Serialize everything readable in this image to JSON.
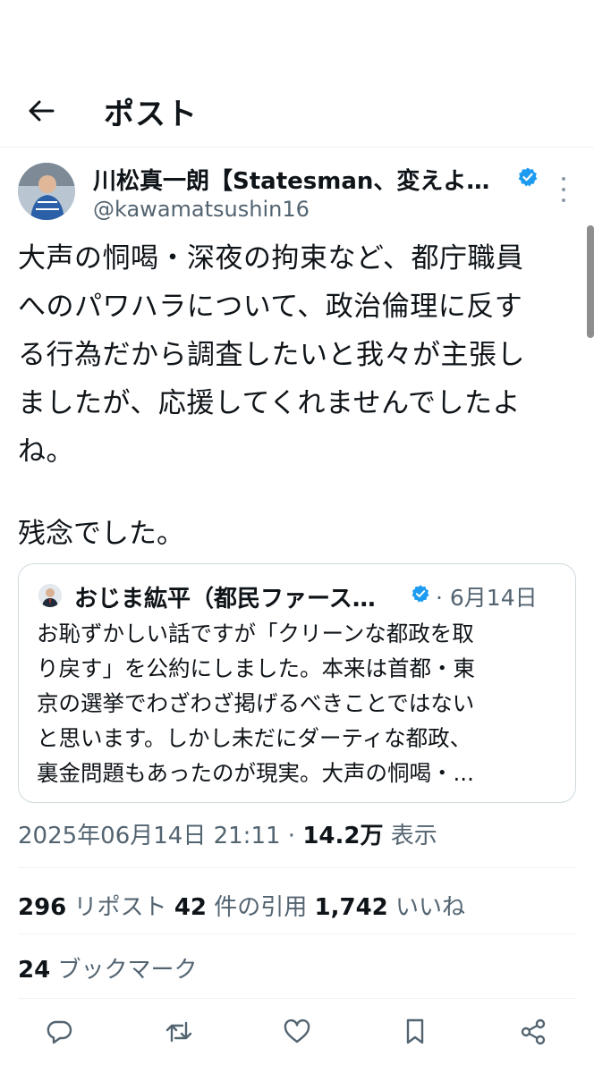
{
  "header": {
    "title": "ポスト",
    "back_icon": "arrow-left-icon"
  },
  "author": {
    "name": "川松真一朗【Statesman、変えよ…",
    "handle": "@kawamatsushin16",
    "verified_icon": "verified-badge-icon",
    "verified_color": "#1d9bf0"
  },
  "tweet": {
    "lines": [
      "大声の恫喝・深夜の拘束など、都庁職員",
      "へのパワハラについて、政治倫理に反す",
      "る行為だから調査したいと我々が主張し",
      "ましたが、応援してくれませんでしたよ",
      "ね。"
    ],
    "extra": "残念でした。"
  },
  "quote": {
    "name": "おじま紘平（都民ファース…",
    "date": "· 6月14日",
    "lines": [
      "お恥ずかしい話ですが「クリーンな都政を取",
      "り戻す」を公約にしました。本来は首都・東",
      "京の選挙でわざわざ掲げるべきことではない",
      "と思います。しかし未だにダーティな都政、",
      "裏金問題もあったのが現実。大声の恫喝・..."
    ]
  },
  "meta": {
    "timestamp": "2025年06月14日 21:11 · ",
    "views": "14.2万",
    "views_label": " 表示"
  },
  "stats": {
    "reposts": "296",
    "reposts_label": " リポスト  ",
    "quotes": "42",
    "quotes_label": " 件の引用  ",
    "likes": "1,742",
    "likes_label": " いいね",
    "bookmarks": "24",
    "bookmarks_label": " ブックマーク"
  },
  "actions": [
    "reply-icon",
    "repost-icon",
    "like-icon",
    "bookmark-icon",
    "share-icon"
  ]
}
